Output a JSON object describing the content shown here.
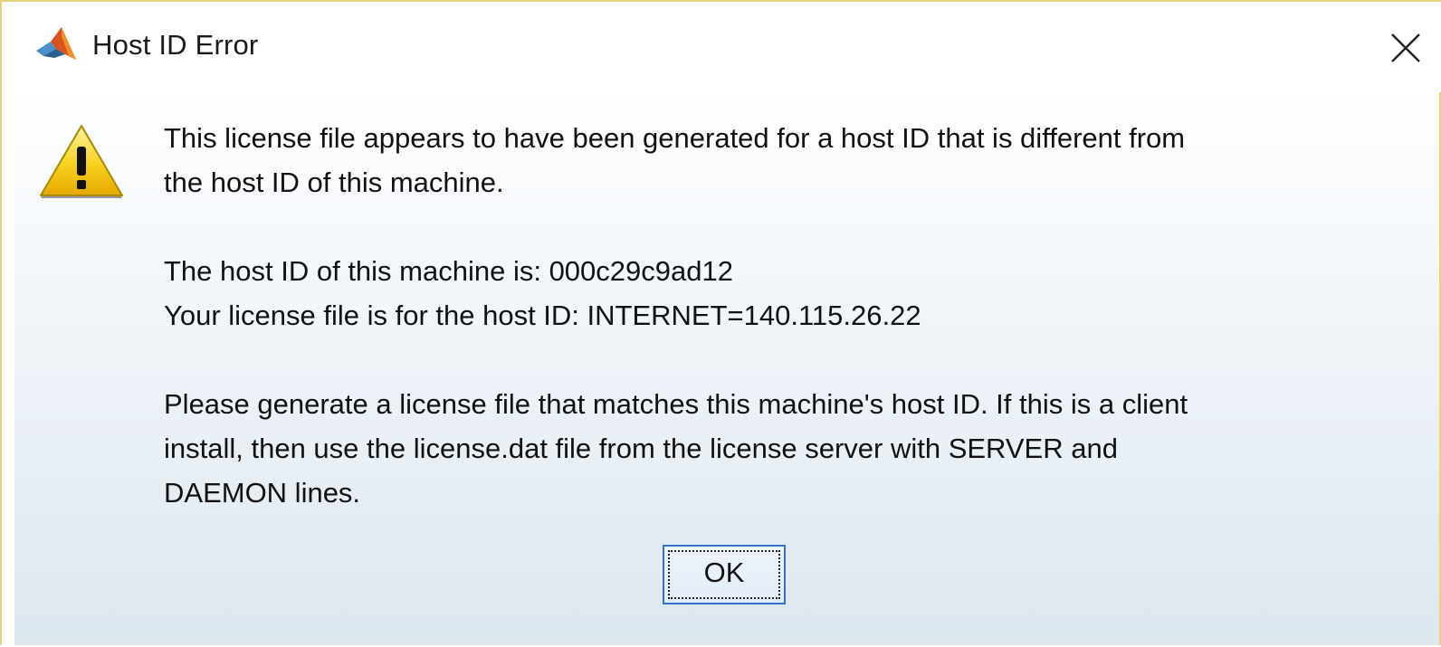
{
  "window": {
    "title": "Host ID Error",
    "app_icon": "matlab-logo-icon",
    "close_icon": "close-icon"
  },
  "message": {
    "icon": "warning-icon",
    "paragraph1": {
      "line1": "This license file appears to have been generated for a host ID that is different from",
      "line2": "the host ID of this machine."
    },
    "paragraph2": {
      "line1": "The host ID of this machine is: 000c29c9ad12",
      "line2": "Your license file is for the host ID: INTERNET=140.115.26.22"
    },
    "paragraph3": {
      "line1": "Please generate a license file that matches this machine's host ID. If this is a client",
      "line2": "install, then use the license.dat file from the license server with SERVER and",
      "line3": "DAEMON lines."
    }
  },
  "buttons": {
    "ok_label": "OK"
  },
  "colors": {
    "border": "#e8d57a",
    "button_border": "#2f73c9",
    "gradient_bottom": "#dde7ef"
  }
}
